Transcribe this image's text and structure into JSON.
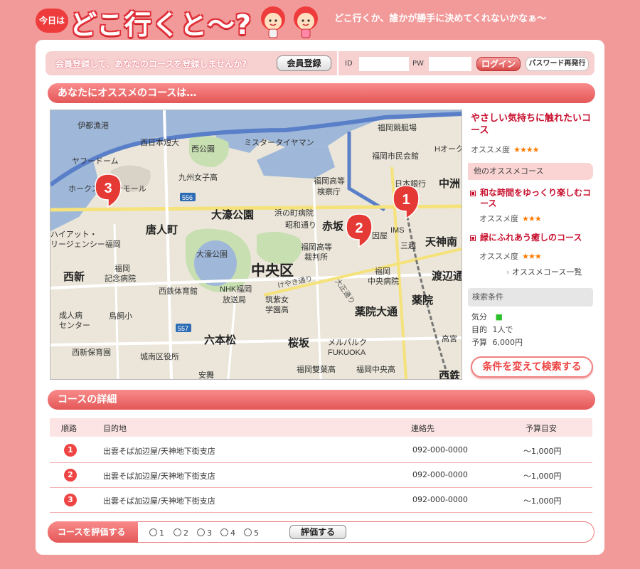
{
  "header": {
    "badge": "今日は",
    "title": "どこ行くと〜?",
    "tagline": "どこ行くか、誰かが勝手に決めてくれないかなぁ〜"
  },
  "login": {
    "message": "会員登録して、あなたのコースを登録しませんか?",
    "register_label": "会員登録",
    "id_label": "ID",
    "id_value": "",
    "pw_label": "PW",
    "pw_value": "",
    "login_label": "ログイン",
    "reissue_label": "パスワード再発行"
  },
  "recommend": {
    "heading": "あなたにオススメのコースは…"
  },
  "map": {
    "labels": [
      "伊都漁港",
      "西日本短大",
      "西公園",
      "ミスタータイヤマン",
      "福岡競艇場",
      "福岡市民会館",
      "ヤフードーム",
      "九州女子高",
      "福岡高等検察庁",
      "日本銀行",
      "Hオーク",
      "中洲",
      "ホークスタウンモール",
      "大濠公園",
      "浜の町病院",
      "赤坂",
      "唐人町",
      "ハイアット・リージェンシー福岡",
      "大濠公園",
      "福岡高等裁判所",
      "天神南",
      "三越",
      "中央区",
      "西新",
      "福岡記念病院",
      "福岡中央病院",
      "渡辺通",
      "西鉄",
      "西鉄体育館",
      "NHK福岡放送局",
      "けやき通り",
      "筑紫女学園高",
      "薬院大通",
      "薬院",
      "成人病センター",
      "鳥飼小",
      "六本松",
      "桜坂",
      "メルパルクFUKUOKA",
      "高宮",
      "西新保育園",
      "城南区役所",
      "福岡雙葉高",
      "福岡中央高",
      "安舞",
      "IMS",
      "因屋",
      "西鉄"
    ],
    "roads": [
      "556",
      "557",
      "けやき通り",
      "大正通り",
      "昭和通り"
    ],
    "markers": [
      "1",
      "2",
      "3"
    ]
  },
  "sidebar": {
    "course_title": "やさしい気持ちに触れたいコース",
    "rec_label": "オススメ度",
    "rec_stars": "★★★★",
    "other_heading": "他のオススメコース",
    "others": [
      {
        "title": "和な時間をゆっくり楽しむコース",
        "rec_label": "オススメ度",
        "stars": "★★★"
      },
      {
        "title": "緑にふれあう癒しのコース",
        "rec_label": "オススメ度",
        "stars": "★★★"
      }
    ],
    "more_link": "オススメコース一覧",
    "cond_heading": "検索条件",
    "conditions": [
      {
        "label": "気分",
        "value": "■",
        "value_color": "#2cc12c"
      },
      {
        "label": "目的",
        "value": "1人で"
      },
      {
        "label": "予算",
        "value": "6,000円"
      }
    ],
    "search_button": "条件を変えて検索する"
  },
  "details": {
    "heading": "コースの詳細",
    "columns": [
      "順路",
      "目的地",
      "連絡先",
      "予算目安"
    ],
    "rows": [
      {
        "num": "1",
        "dest": "出雲そば加辺屋/天神地下街支店",
        "tel": "092-000-0000",
        "budget": "〜1,000円"
      },
      {
        "num": "2",
        "dest": "出雲そば加辺屋/天神地下街支店",
        "tel": "092-000-0000",
        "budget": "〜1,000円"
      },
      {
        "num": "3",
        "dest": "出雲そば加辺屋/天神地下街支店",
        "tel": "092-000-0000",
        "budget": "〜1,000円"
      }
    ]
  },
  "rating": {
    "heading": "コースを評価する",
    "options": [
      "1",
      "2",
      "3",
      "4",
      "5"
    ],
    "submit_label": "評価する"
  },
  "colors": {
    "page_bg": "#f29a9a",
    "accent_red": "#e45757",
    "title_red": "#c8102e",
    "star_orange": "#ff7a00",
    "marker_red": "#e53935"
  }
}
